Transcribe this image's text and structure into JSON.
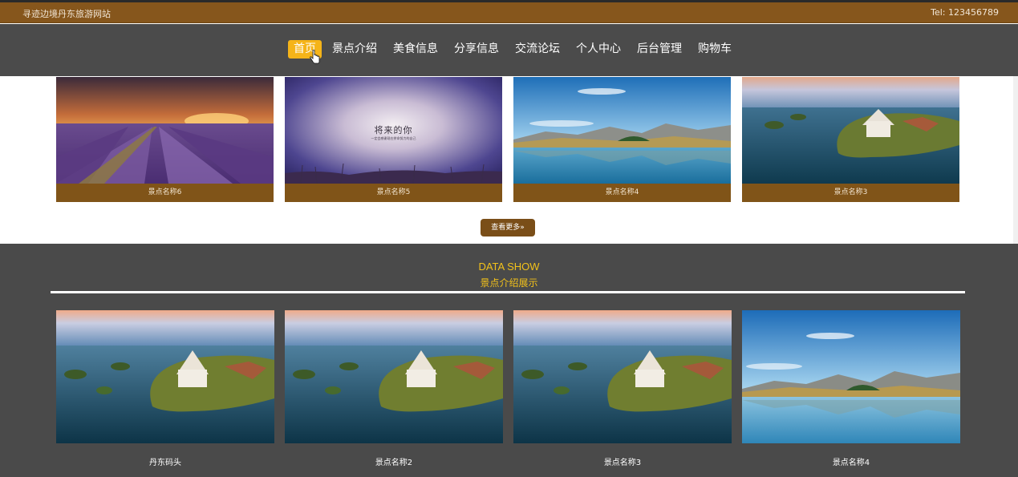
{
  "topbar": {
    "site_title": "寻迹边境丹东旅游网站",
    "tel": "Tel:  123456789"
  },
  "nav": {
    "items": [
      {
        "label": "首页",
        "active": true
      },
      {
        "label": "景点介绍",
        "active": false
      },
      {
        "label": "美食信息",
        "active": false
      },
      {
        "label": "分享信息",
        "active": false
      },
      {
        "label": "交流论坛",
        "active": false
      },
      {
        "label": "个人中心",
        "active": false
      },
      {
        "label": "后台管理",
        "active": false
      },
      {
        "label": "购物车",
        "active": false
      }
    ]
  },
  "top_cards": [
    {
      "name": "景点名称6",
      "image": "lavender-sunset"
    },
    {
      "name": "景点名称5",
      "image": "purple-sky-poster",
      "poster_title": "将来的你",
      "poster_subtitle": "一定会感谢现在拼命努力的自己"
    },
    {
      "name": "景点名称4",
      "image": "mountain-lake"
    },
    {
      "name": "景点名称3",
      "image": "island-castle"
    }
  ],
  "more_button": "查看更多",
  "data_show": {
    "title_en": "DATA SHOW",
    "title_cn": "景点介绍展示"
  },
  "bottom_cards": [
    {
      "name": "丹东码头",
      "image": "island-castle"
    },
    {
      "name": "景点名称2",
      "image": "island-castle"
    },
    {
      "name": "景点名称3",
      "image": "island-castle"
    },
    {
      "name": "景点名称4",
      "image": "mountain-lake"
    }
  ],
  "colors": {
    "topbar": "#86561c",
    "nav_bg": "#4b4b4b",
    "active_nav": "#f5b419",
    "caption_bg": "#805418",
    "accent_yellow": "#f3c21a"
  }
}
